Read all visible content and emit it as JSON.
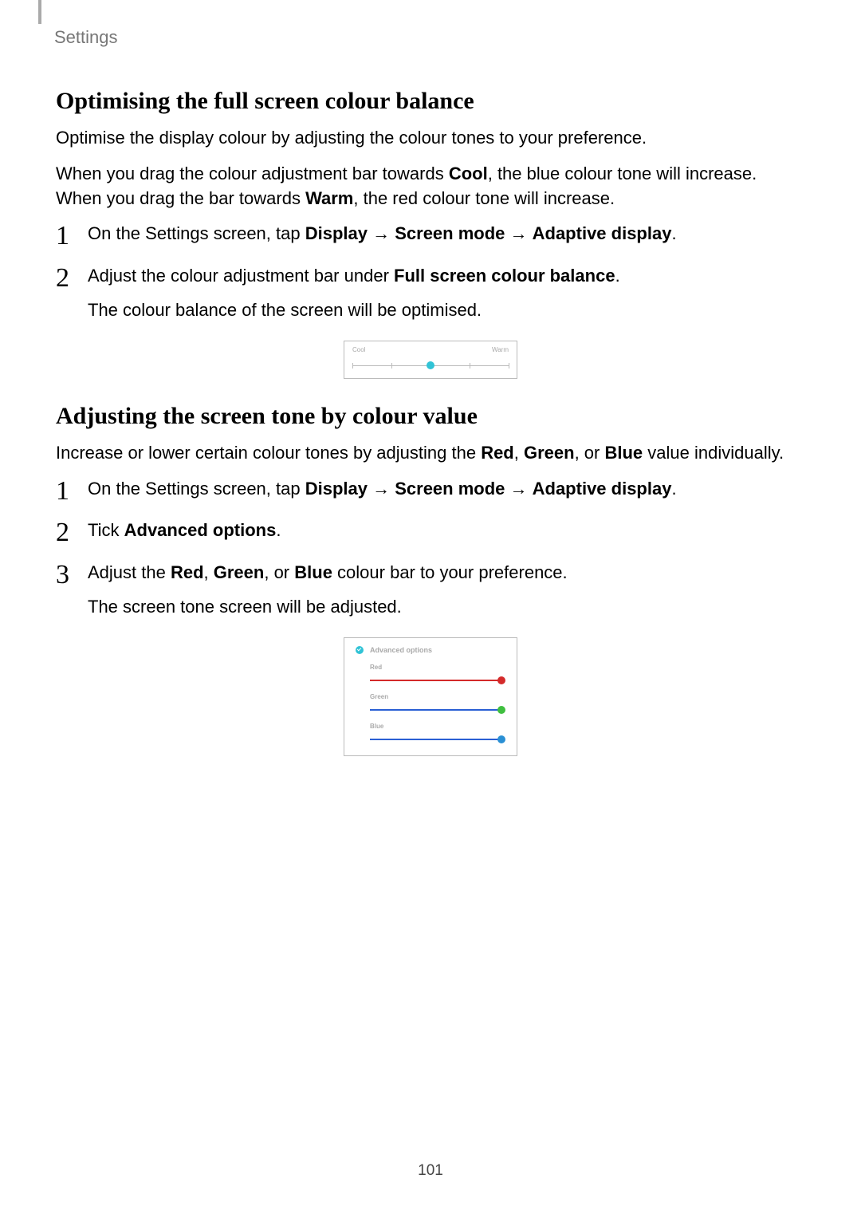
{
  "header": {
    "section": "Settings"
  },
  "section1": {
    "title": "Optimising the full screen colour balance",
    "intro": "Optimise the display colour by adjusting the colour tones to your preference.",
    "p2a": "When you drag the colour adjustment bar towards ",
    "p2b": "Cool",
    "p2c": ", the blue colour tone will increase. When you drag the bar towards ",
    "p2d": "Warm",
    "p2e": ", the red colour tone will increase.",
    "step1": {
      "a": "On the Settings screen, tap ",
      "b": "Display",
      "arrow1": " → ",
      "c": "Screen mode",
      "arrow2": " → ",
      "d": "Adaptive display",
      "e": "."
    },
    "step2": {
      "a": "Adjust the colour adjustment bar under ",
      "b": "Full screen colour balance",
      "c": ".",
      "sub": "The colour balance of the screen will be optimised."
    }
  },
  "figure1": {
    "left_label": "Cool",
    "right_label": "Warm"
  },
  "section2": {
    "title": "Adjusting the screen tone by colour value",
    "p1a": "Increase or lower certain colour tones by adjusting the ",
    "p1b": "Red",
    "p1c": ", ",
    "p1d": "Green",
    "p1e": ", or ",
    "p1f": "Blue",
    "p1g": " value individually.",
    "step1": {
      "a": "On the Settings screen, tap ",
      "b": "Display",
      "arrow1": " → ",
      "c": "Screen mode",
      "arrow2": " → ",
      "d": "Adaptive display",
      "e": "."
    },
    "step2": {
      "a": "Tick ",
      "b": "Advanced options",
      "c": "."
    },
    "step3": {
      "a": "Adjust the ",
      "b": "Red",
      "c": ", ",
      "d": "Green",
      "e": ", or ",
      "f": "Blue",
      "g": " colour bar to your preference.",
      "sub": "The screen tone screen will be adjusted."
    }
  },
  "figure2": {
    "title": "Advanced options",
    "rows": {
      "red": {
        "label": "Red",
        "line_color": "#d42a2a",
        "thumb_color": "#d42a2a"
      },
      "green": {
        "label": "Green",
        "line_color": "#2a5fd4",
        "thumb_color": "#3fbf3f"
      },
      "blue": {
        "label": "Blue",
        "line_color": "#2a5fd4",
        "thumb_color": "#2a8fd4"
      }
    }
  },
  "page_number": "101"
}
